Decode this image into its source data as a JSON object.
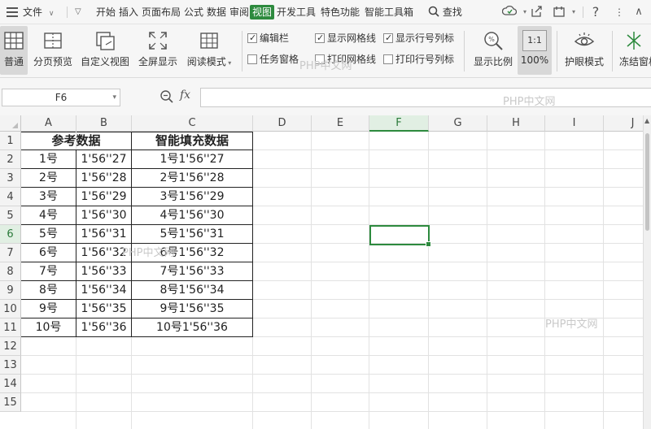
{
  "menubar": {
    "file_label": "文件",
    "tabs": [
      "开始",
      "插入",
      "页面布局",
      "公式",
      "数据",
      "审阅",
      "视图",
      "开发工具",
      "特色功能",
      "智能工具箱"
    ],
    "active_tab": "视图",
    "search_label": "查找"
  },
  "ribbon": {
    "normal": "普通",
    "page_break_preview": "分页预览",
    "custom_view": "自定义视图",
    "full_screen": "全屏显示",
    "reading_mode": "阅读模式",
    "checks": {
      "formula_bar": {
        "label": "编辑栏",
        "checked": true
      },
      "task_pane": {
        "label": "任务窗格",
        "checked": false
      },
      "show_gridlines": {
        "label": "显示网格线",
        "checked": true
      },
      "print_gridlines": {
        "label": "打印网格线",
        "checked": false
      },
      "show_headers": {
        "label": "显示行号列标",
        "checked": true
      },
      "print_headers": {
        "label": "打印行号列标",
        "checked": false
      }
    },
    "zoom": "显示比例",
    "zoom_100": "100%",
    "zoom_100_icon": "1:1",
    "eye_mode": "护眼模式",
    "freeze": "冻结窗格"
  },
  "formula_bar": {
    "cell_ref": "F6",
    "fx": "fx",
    "value": ""
  },
  "watermarks": [
    "PHP中文网",
    "PHP中文网",
    "PHP中文网",
    "PHP中文网"
  ],
  "sheet": {
    "columns": [
      "A",
      "B",
      "C",
      "D",
      "E",
      "F",
      "G",
      "H",
      "I",
      "J"
    ],
    "rows": [
      "1",
      "2",
      "3",
      "4",
      "5",
      "6",
      "7",
      "8",
      "9",
      "10",
      "11",
      "12",
      "13",
      "14",
      "15"
    ],
    "selected_cell": "F6",
    "table": [
      [
        "参考数据",
        "",
        "智能填充数据"
      ],
      [
        "1号",
        "1'56''27",
        "1号1'56''27"
      ],
      [
        "2号",
        "1'56''28",
        "2号1'56''28"
      ],
      [
        "3号",
        "1'56''29",
        "3号1'56''29"
      ],
      [
        "4号",
        "1'56''30",
        "4号1'56''30"
      ],
      [
        "5号",
        "1'56''31",
        "5号1'56''31"
      ],
      [
        "6号",
        "1'56''32",
        "6号1'56''32"
      ],
      [
        "7号",
        "1'56''33",
        "7号1'56''33"
      ],
      [
        "8号",
        "1'56''34",
        "8号1'56''34"
      ],
      [
        "9号",
        "1'56''35",
        "9号1'56''35"
      ],
      [
        "10号",
        "1'56''36",
        "10号1'56''36"
      ]
    ]
  }
}
